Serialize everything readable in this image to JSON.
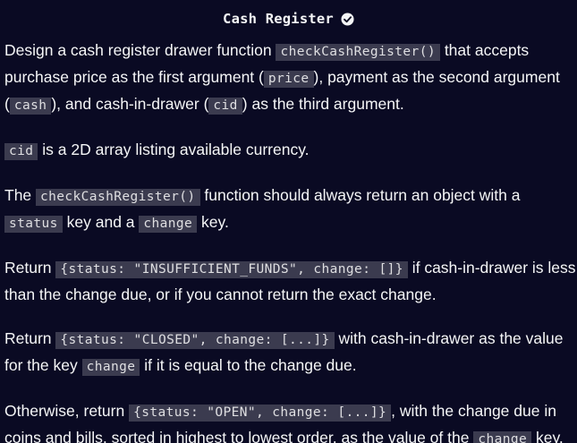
{
  "title": "Cash Register",
  "paragraphs": {
    "p1": {
      "t1": "Design a cash register drawer function ",
      "c1": "checkCashRegister()",
      "t2": " that accepts purchase price as the first argument (",
      "c2": "price",
      "t3": "), payment as the second argument (",
      "c3": "cash",
      "t4": "), and cash-in-drawer (",
      "c4": "cid",
      "t5": ") as the third argument."
    },
    "p2": {
      "c1": "cid",
      "t1": " is a 2D array listing available currency."
    },
    "p3": {
      "t1": "The ",
      "c1": "checkCashRegister()",
      "t2": " function should always return an object with a ",
      "c2": "status",
      "t3": " key and a ",
      "c3": "change",
      "t4": " key."
    },
    "p4": {
      "t1": "Return ",
      "c1": "{status: \"INSUFFICIENT_FUNDS\", change: []}",
      "t2": " if cash-in-drawer is less than the change due, or if you cannot return the exact change."
    },
    "p5": {
      "t1": "Return ",
      "c1": "{status: \"CLOSED\", change: [...]}",
      "t2": " with cash-in-drawer as the value for the key ",
      "c2": "change",
      "t3": " if it is equal to the change due."
    },
    "p6": {
      "t1": "Otherwise, return ",
      "c1": "{status: \"OPEN\", change: [...]}",
      "t2": ", with the change due in coins and bills, sorted in highest to lowest order, as the value of the ",
      "c2": "change",
      "t3": " key."
    }
  },
  "icons": {
    "completed": "check-circle-icon"
  },
  "colors": {
    "background": "#0a0a23",
    "text": "#f5f6f7",
    "code_bg": "#3b3b4f"
  }
}
